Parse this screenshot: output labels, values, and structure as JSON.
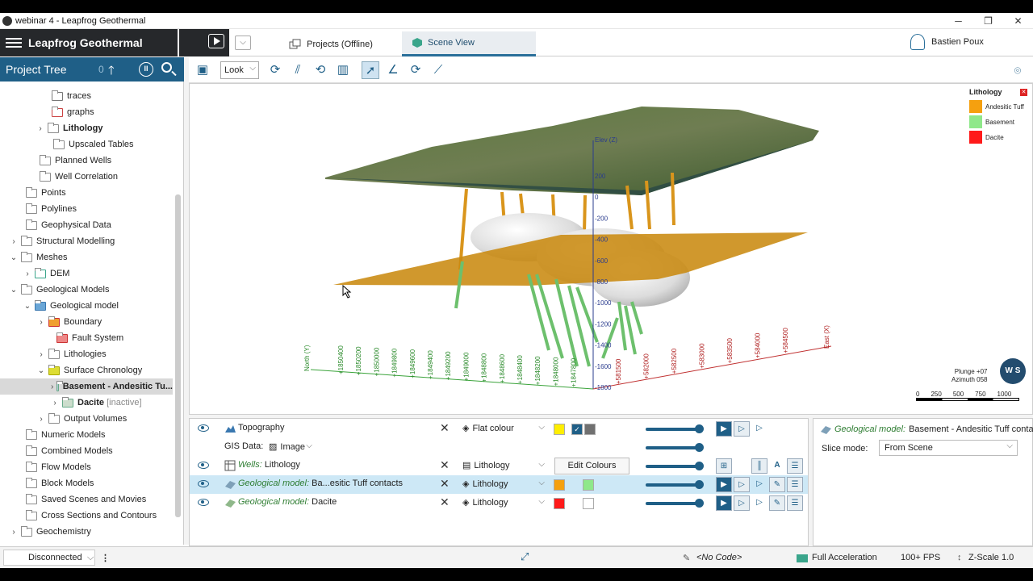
{
  "window": {
    "title": "webinar 4 - Leapfrog Geothermal"
  },
  "header": {
    "brand": "Leapfrog Geothermal",
    "tabs": [
      {
        "label": "Projects (Offline)"
      },
      {
        "label": "Scene View"
      }
    ],
    "user": "Bastien Poux"
  },
  "tree": {
    "title": "Project Tree",
    "count": "0",
    "items": [
      {
        "label": "traces"
      },
      {
        "label": "graphs"
      },
      {
        "label": "Lithology"
      },
      {
        "label": "Upscaled Tables"
      },
      {
        "label": "Planned Wells"
      },
      {
        "label": "Well Correlation"
      },
      {
        "label": "Points"
      },
      {
        "label": "Polylines"
      },
      {
        "label": "Geophysical Data"
      },
      {
        "label": "Structural Modelling"
      },
      {
        "label": "Meshes"
      },
      {
        "label": "DEM"
      },
      {
        "label": "Geological Models"
      },
      {
        "label": "Geological model"
      },
      {
        "label": "Boundary"
      },
      {
        "label": "Fault System"
      },
      {
        "label": "Lithologies"
      },
      {
        "label": "Surface Chronology"
      },
      {
        "label": "Basement - Andesitic Tu..."
      },
      {
        "label": "Dacite",
        "note": "[inactive]"
      },
      {
        "label": "Output Volumes"
      },
      {
        "label": "Numeric Models"
      },
      {
        "label": "Combined Models"
      },
      {
        "label": "Flow Models"
      },
      {
        "label": "Block Models"
      },
      {
        "label": "Saved Scenes and Movies"
      },
      {
        "label": "Cross Sections and Contours"
      },
      {
        "label": "Geochemistry"
      }
    ]
  },
  "toolbar": {
    "look": "Look"
  },
  "scene": {
    "legend": {
      "title": "Lithology",
      "items": [
        {
          "label": "Andesitic Tuff",
          "color": "#f5a00f"
        },
        {
          "label": "Basement",
          "color": "#8fe88a"
        },
        {
          "label": "Dacite",
          "color": "#ff1a1a"
        }
      ]
    },
    "elevation_label": "Elev (Z)",
    "depth_ticks": [
      "200",
      "0",
      "-200",
      "-400",
      "-600",
      "-800",
      "-1000",
      "-1200",
      "-1400",
      "-1600",
      "-1800"
    ],
    "north_label": "North (Y)",
    "north_ticks": [
      "+1850400",
      "+1850200",
      "+1850000",
      "+1849800",
      "+1849600",
      "+1849400",
      "+1849200",
      "+1849000",
      "+1848800",
      "+1848600",
      "+1848400",
      "+1848200",
      "+1848000",
      "+1847800"
    ],
    "east_label": "East (X)",
    "east_ticks": [
      "+581500",
      "+582000",
      "+582500",
      "+583000",
      "+583500",
      "+584000",
      "+584500"
    ],
    "plunge": "Plunge +07",
    "azimuth": "Azimuth 058",
    "logo": "W S",
    "scale": [
      "0",
      "250",
      "500",
      "750",
      "1000"
    ]
  },
  "shapes": {
    "rows": [
      {
        "name": "Topography",
        "mode": "Flat colour",
        "color1": "#ffee00",
        "color2": "#707070"
      },
      {
        "name": "GIS Data:",
        "mode": "Image"
      },
      {
        "prefix": "Wells:",
        "name": "Lithology",
        "mode": "Lithology",
        "button": "Edit Colours"
      },
      {
        "prefix": "Geological model:",
        "name": "Ba...esitic Tuff contacts",
        "mode": "Lithology",
        "color1": "#f5a00f",
        "color2": "#8fe88a"
      },
      {
        "prefix": "Geological model:",
        "name": "Dacite",
        "mode": "Lithology",
        "color1": "#ff1a1a",
        "color2": "#ffffff"
      }
    ]
  },
  "properties": {
    "prefix": "Geological model:",
    "title": "Basement - Andesitic Tuff conta...",
    "slice_label": "Slice mode:",
    "slice_value": "From Scene"
  },
  "status": {
    "connection": "Disconnected",
    "code": "<No Code>",
    "accel": "Full Acceleration",
    "fps": "100+ FPS",
    "zscale": "Z-Scale 1.0"
  }
}
